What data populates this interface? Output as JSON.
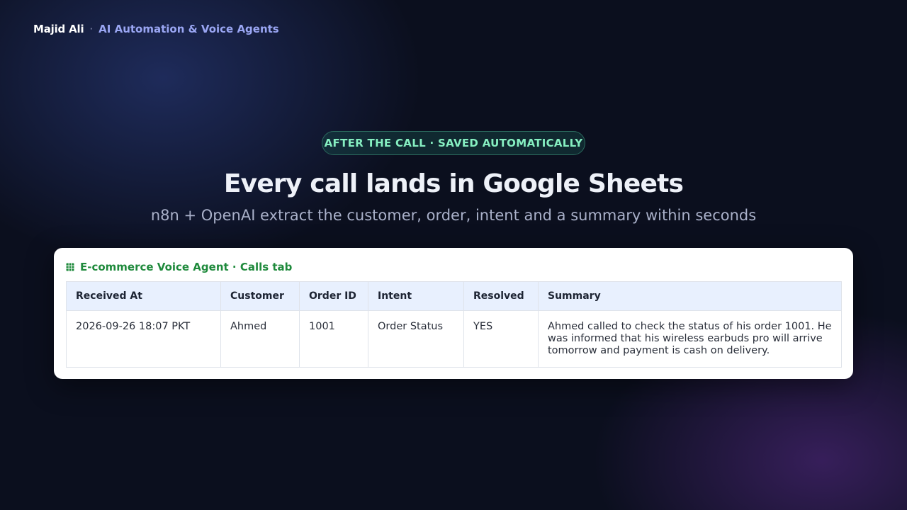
{
  "header": {
    "brand_name": "Majid Ali",
    "separator": "·",
    "tagline": "AI Automation & Voice Agents"
  },
  "hero": {
    "badge": "AFTER THE CALL · SAVED AUTOMATICALLY",
    "title": "Every call lands in Google Sheets",
    "subtitle": "n8n + OpenAI extract the customer, order, intent and a summary within seconds"
  },
  "sheet": {
    "icon": "spreadsheet-icon",
    "title": "E-commerce Voice Agent · Calls tab",
    "columns": [
      "Received At",
      "Customer",
      "Order ID",
      "Intent",
      "Resolved",
      "Summary"
    ],
    "rows": [
      [
        "2026-09-26 18:07 PKT",
        "Ahmed",
        "1001",
        "Order Status",
        "YES",
        "Ahmed called to check the status of his order 1001. He was informed that his wireless earbuds pro will arrive tomorrow and payment is cash on delivery."
      ]
    ]
  },
  "colors": {
    "background": "#0b0f1e",
    "accent_green": "#1f8a3c",
    "badge_text": "#86efc1",
    "tagline": "#9aa6f3",
    "table_header_bg": "#e8f0fe"
  }
}
